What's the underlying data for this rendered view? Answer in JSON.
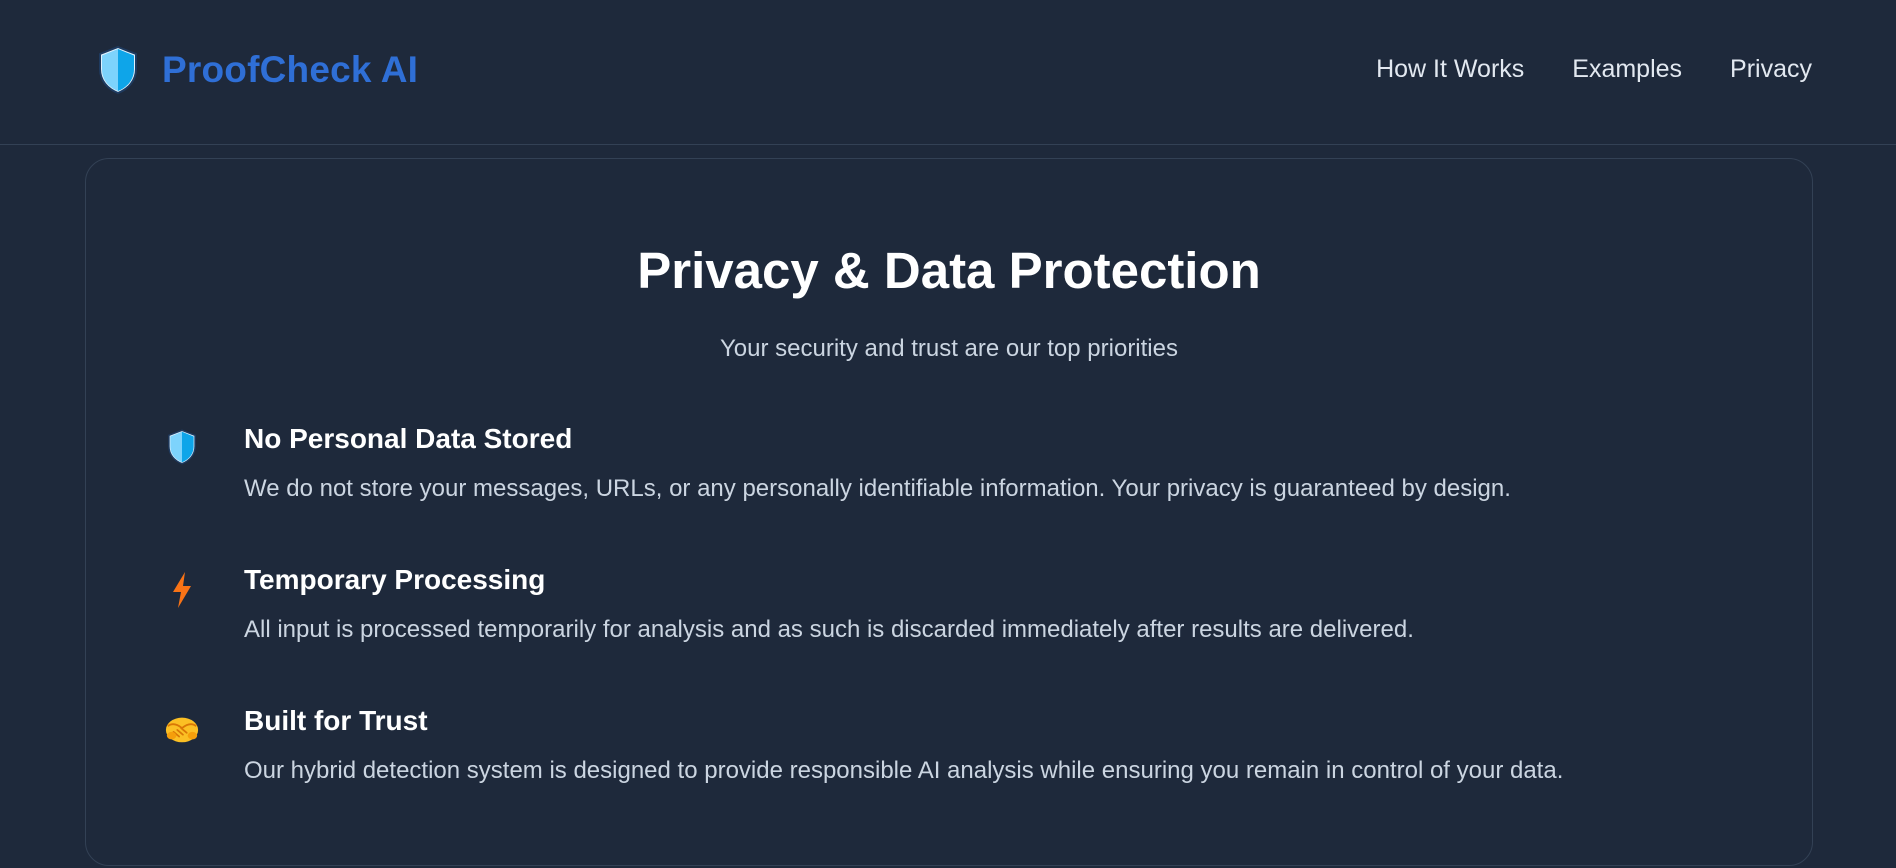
{
  "header": {
    "brand_name": "ProofCheck AI",
    "brand_icon": "shield-icon",
    "nav": [
      {
        "label": "How It Works"
      },
      {
        "label": "Examples"
      },
      {
        "label": "Privacy"
      }
    ]
  },
  "privacy": {
    "title": "Privacy & Data Protection",
    "subtitle": "Your security and trust are our top priorities",
    "features": [
      {
        "icon": "shield-icon",
        "title": "No Personal Data Stored",
        "description": "We do not store your messages, URLs, or any personally identifiable information. Your privacy is guaranteed by design."
      },
      {
        "icon": "lightning-icon",
        "title": "Temporary Processing",
        "description": "All input is processed temporarily for analysis and as such is discarded immediately after results are delivered."
      },
      {
        "icon": "handshake-icon",
        "title": "Built for Trust",
        "description": "Our hybrid detection system is designed to provide responsible AI analysis while ensuring you remain in control of your data."
      }
    ]
  },
  "colors": {
    "background": "#1e293b",
    "brand": "#2f6fd6",
    "shield_light": "#7dd3fc",
    "shield_dark": "#0ea5e9",
    "lightning": "#f97316",
    "handshake": "#fbbf24"
  }
}
